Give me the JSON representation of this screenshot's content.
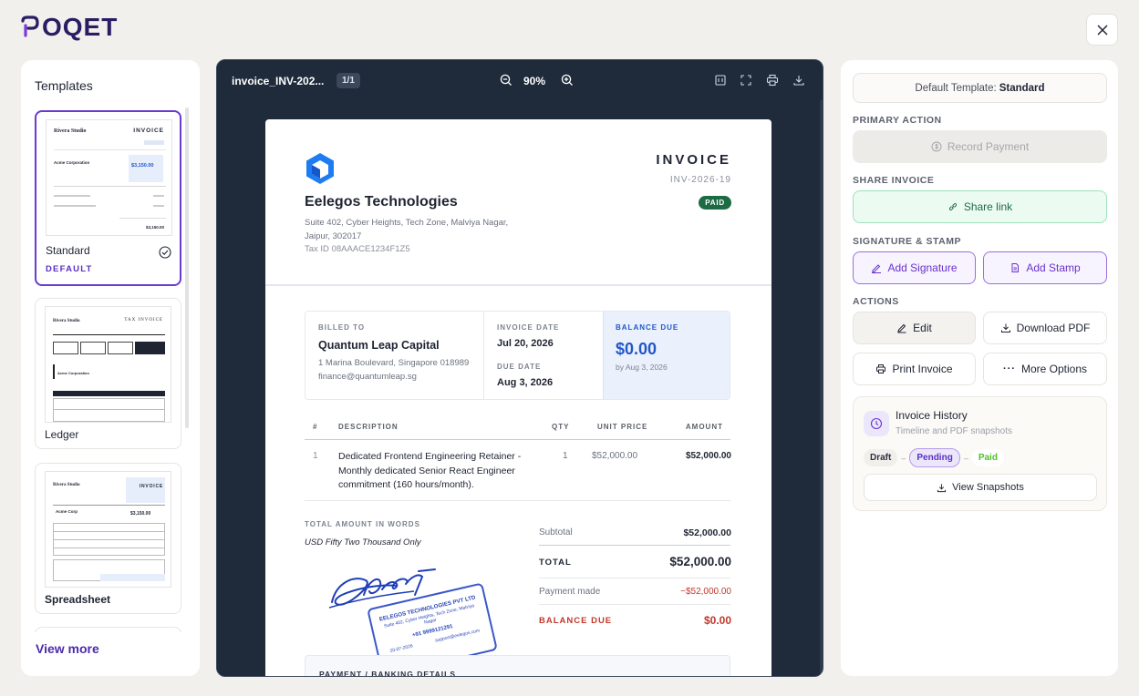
{
  "app": {
    "logo_text": "OQET",
    "logo_colors": {
      "primary": "#2a1d63",
      "accent": "#7b3ad9"
    }
  },
  "templates": {
    "heading": "Templates",
    "items": [
      {
        "name": "Standard",
        "badge": "DEFAULT",
        "selected": true
      },
      {
        "name": "Ledger",
        "badge": "",
        "selected": false
      },
      {
        "name": "Spreadsheet",
        "badge": "",
        "selected": false
      }
    ],
    "view_more": "View more",
    "thumb_texts": {
      "studio": "Rivera Studio",
      "invoice": "INVOICE",
      "tax_invoice": "TAX INVOICE",
      "client": "Acme Corporation",
      "amount": "$3,150.00",
      "client_short": "Acme Corp"
    }
  },
  "viewer": {
    "filename": "invoice_INV-202...",
    "page_indicator": "1/1",
    "zoom": "90%"
  },
  "invoice": {
    "title": "INVOICE",
    "number": "INV-2026-19",
    "status": "PAID",
    "company": "Eelegos Technologies",
    "address": "Suite 402, Cyber Heights, Tech Zone, Malviya Nagar, Jaipur, 302017",
    "tax_id": "Tax ID 08AAACE1234F1Z5",
    "billed_to_label": "BILLED TO",
    "client_name": "Quantum Leap Capital",
    "client_address": "1 Marina Boulevard, Singapore 018989",
    "client_email": "finance@quantumleap.sg",
    "invoice_date_label": "INVOICE DATE",
    "invoice_date": "Jul 20, 2026",
    "due_date_label": "DUE DATE",
    "due_date": "Aug 3, 2026",
    "balance_due_label": "BALANCE DUE",
    "balance_due": "$0.00",
    "balance_due_by": "by Aug 3, 2026",
    "table_headers": {
      "num": "#",
      "desc": "DESCRIPTION",
      "qty": "QTY",
      "unit": "UNIT PRICE",
      "amount": "AMOUNT"
    },
    "line_items": [
      {
        "num": "1",
        "description": "Dedicated Frontend Engineering Retainer - Monthly dedicated Senior React Engineer commitment (160 hours/month).",
        "qty": "1",
        "unit_price": "$52,000.00",
        "amount": "$52,000.00"
      }
    ],
    "words_label": "TOTAL AMOUNT IN WORDS",
    "words": "USD Fifty Two Thousand Only",
    "subtotal_label": "Subtotal",
    "subtotal": "$52,000.00",
    "total_label": "TOTAL",
    "total": "$52,000.00",
    "payment_label": "Payment made",
    "payment": "−$52,000.00",
    "balance_label": "BALANCE DUE",
    "balance": "$0.00",
    "payment_details_label": "PAYMENT / BANKING DETAILS",
    "stamp": {
      "company": "EELEGOS TECHNOLOGIES PVT LTD",
      "address": "Suite 402, Cyber Heights, Tech Zone, Malviya Nagar",
      "phone": "+91 9999121291",
      "date": "20-07-2026",
      "email": "support@eelegos.com"
    }
  },
  "panel": {
    "default_template_label": "Default Template:",
    "default_template_value": "Standard",
    "primary_action_label": "PRIMARY ACTION",
    "record_payment": "Record Payment",
    "share_invoice_label": "SHARE INVOICE",
    "share_link": "Share link",
    "signature_stamp_label": "SIGNATURE & STAMP",
    "add_signature": "Add Signature",
    "add_stamp": "Add Stamp",
    "actions_label": "ACTIONS",
    "edit": "Edit",
    "download_pdf": "Download PDF",
    "print_invoice": "Print Invoice",
    "more_options": "More Options",
    "history_title": "Invoice History",
    "history_sub": "Timeline and PDF snapshots",
    "timeline": [
      "Draft",
      "Pending",
      "Paid"
    ],
    "view_snapshots": "View Snapshots"
  },
  "colors": {
    "accent": "#6b3ad1",
    "paid_green": "#1d6b45",
    "balance_blue": "#2356c8",
    "danger": "#c0392b",
    "share_green": "#1f7a4f"
  }
}
